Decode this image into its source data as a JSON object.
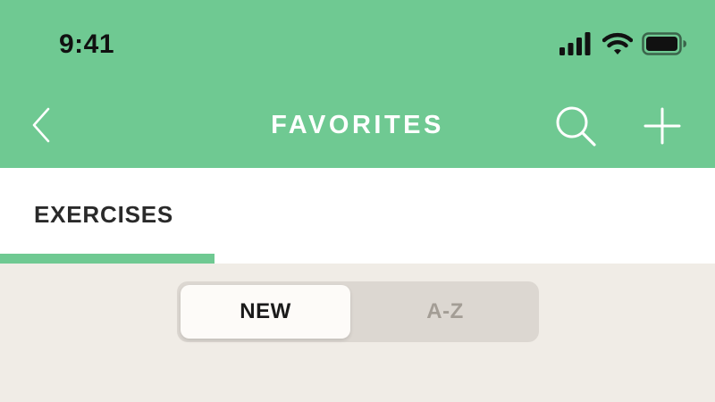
{
  "status_bar": {
    "time": "9:41",
    "icons": [
      "cellular-signal-icon",
      "wifi-icon",
      "battery-icon"
    ]
  },
  "nav": {
    "title": "FAVORITES",
    "icons": [
      "chevron-left-icon",
      "search-icon",
      "plus-icon"
    ]
  },
  "tabs": [
    {
      "label": "EXERCISES",
      "active": true
    }
  ],
  "segmented_control": {
    "options": [
      {
        "label": "NEW",
        "selected": true
      },
      {
        "label": "A-Z",
        "selected": false
      }
    ]
  },
  "colors": {
    "header": "#6fc992",
    "background": "#f0ece6",
    "tab_background": "#ffffff",
    "indicator": "#6fc992",
    "segment_track": "#dcd7d1",
    "segment_selected": "#fdfbf8",
    "segment_unselected_text": "#a39d95"
  }
}
